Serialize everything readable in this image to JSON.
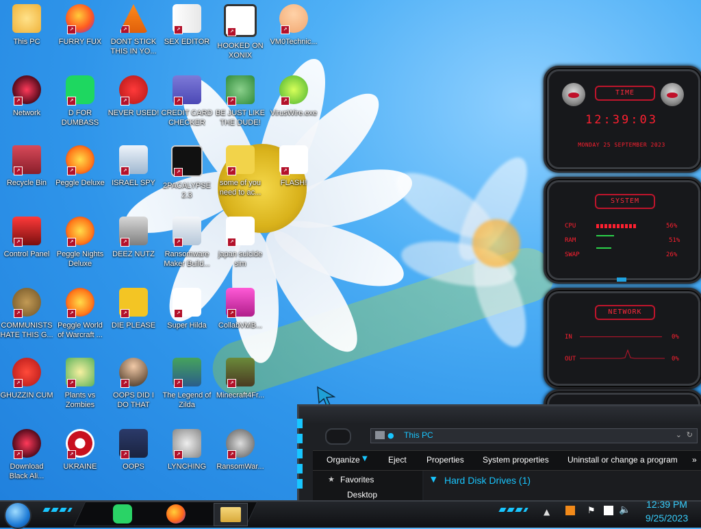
{
  "desktop": {
    "icons": [
      {
        "label": "This PC"
      },
      {
        "label": "FURRY FUX"
      },
      {
        "label": "DONT STICK THIS IN YO..."
      },
      {
        "label": "SEX EDITOR"
      },
      {
        "label": "HOOKED ON XONIX"
      },
      {
        "label": "VM0Technic..."
      },
      {
        "label": "Network"
      },
      {
        "label": "D FOR DUMBASS"
      },
      {
        "label": "NEVER USED!"
      },
      {
        "label": "CREDIT CARD CHECKER"
      },
      {
        "label": "BE JUST LIKE THE DUDE!"
      },
      {
        "label": "VirusWire.exe"
      },
      {
        "label": "Recycle Bin"
      },
      {
        "label": "Peggle Deluxe"
      },
      {
        "label": "ISRAEL SPY"
      },
      {
        "label": "2PACALYPSE 2.3"
      },
      {
        "label": "some of you need to ac..."
      },
      {
        "label": "FLASH!"
      },
      {
        "label": "Control Panel"
      },
      {
        "label": "Peggle Nights Deluxe"
      },
      {
        "label": "DEEZ NUTZ"
      },
      {
        "label": "Ransomware Maker Build..."
      },
      {
        "label": "japan suicide sim"
      },
      {
        "label": "COMMUNISTS HATE THIS G..."
      },
      {
        "label": "Peggle World of Warcraft ..."
      },
      {
        "label": "DIE PLEASE"
      },
      {
        "label": "Super Hilda"
      },
      {
        "label": "CollabVMB..."
      },
      {
        "label": "GHUZZIN CUM"
      },
      {
        "label": "Plants vs Zombies"
      },
      {
        "label": "OOPS DID I DO THAT"
      },
      {
        "label": "The Legend of Zilda"
      },
      {
        "label": "Minecraft4Fr..."
      },
      {
        "label": "Download Black Ali..."
      },
      {
        "label": "UKRAINE"
      },
      {
        "label": "OOPS"
      },
      {
        "label": "LYNCHING"
      },
      {
        "label": "RansomWar..."
      }
    ]
  },
  "gadgets": {
    "time": {
      "title": "TIME",
      "clock": "12:39:03",
      "date": "MONDAY 25 SEPTEMBER 2023"
    },
    "system": {
      "title": "SYSTEM",
      "cpu_label": "CPU",
      "cpu_value": "56%",
      "ram_label": "RAM",
      "ram_value": "51%",
      "swap_label": "SWAP",
      "swap_value": "26%"
    },
    "network": {
      "title": "NETWORK",
      "in_label": "IN",
      "in_value": "0%",
      "out_label": "OUT",
      "out_value": "0%"
    }
  },
  "explorer": {
    "address": "This PC",
    "toolbar": {
      "organize": "Organize",
      "eject": "Eject",
      "properties": "Properties",
      "system_properties": "System properties",
      "uninstall": "Uninstall or change a program",
      "more": "»"
    },
    "nav": {
      "favorites": "Favorites",
      "desktop": "Desktop"
    },
    "content": {
      "group": "Hard Disk Drives (1)"
    }
  },
  "taskbar": {
    "time": "12:39 PM",
    "date": "9/25/2023"
  },
  "colors": {
    "accent_cyan": "#19c6ff",
    "gadget_red": "#ff2030"
  }
}
